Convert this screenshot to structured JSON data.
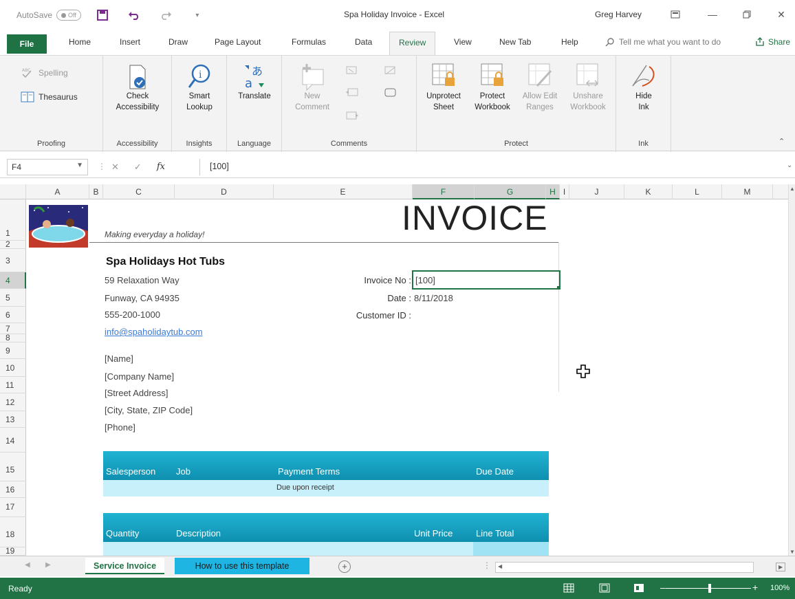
{
  "titlebar": {
    "autosave_label": "AutoSave",
    "autosave_state": "Off",
    "doc_title": "Spa Holiday Invoice  -  Excel",
    "user": "Greg Harvey"
  },
  "tabs": [
    "File",
    "Home",
    "Insert",
    "Draw",
    "Page Layout",
    "Formulas",
    "Data",
    "Review",
    "View",
    "New Tab",
    "Help"
  ],
  "active_tab": "Review",
  "tellme": "Tell me what you want to do",
  "share": "Share",
  "ribbon": {
    "proofing": {
      "spelling": "Spelling",
      "thesaurus": "Thesaurus",
      "label": "Proofing"
    },
    "accessibility": {
      "check_line1": "Check",
      "check_line2": "Accessibility",
      "label": "Accessibility"
    },
    "insights": {
      "smart_line1": "Smart",
      "smart_line2": "Lookup",
      "label": "Insights"
    },
    "language": {
      "translate": "Translate",
      "label": "Language"
    },
    "comments": {
      "new_line1": "New",
      "new_line2": "Comment",
      "label": "Comments"
    },
    "protect": {
      "unprotect_line1": "Unprotect",
      "unprotect_line2": "Sheet",
      "protect_line1": "Protect",
      "protect_line2": "Workbook",
      "allow_line1": "Allow Edit",
      "allow_line2": "Ranges",
      "unshare_line1": "Unshare",
      "unshare_line2": "Workbook",
      "label": "Protect"
    },
    "ink": {
      "hide_line1": "Hide",
      "hide_line2": "Ink",
      "label": "Ink"
    }
  },
  "formula": {
    "namebox": "F4",
    "value": "[100]"
  },
  "columns": [
    "A",
    "B",
    "C",
    "D",
    "E",
    "F",
    "G",
    "H",
    "I",
    "J",
    "K",
    "L",
    "M"
  ],
  "rows": [
    "1",
    "2",
    "3",
    "4",
    "5",
    "6",
    "7",
    "8",
    "9",
    "10",
    "11",
    "12",
    "13",
    "14",
    "15",
    "16",
    "17",
    "18",
    "19"
  ],
  "sheet": {
    "invoice_title": "INVOICE",
    "tagline": "Making everyday a holiday!",
    "company": "Spa Holidays Hot Tubs",
    "address1": "59 Relaxation Way",
    "address2": "Funway, CA 94935",
    "phone": "555-200-1000",
    "email": "info@spaholidaytub.com",
    "bill_name": "[Name]",
    "bill_company": "[Company Name]",
    "bill_street": "[Street Address]",
    "bill_city": "[City, State,  ZIP Code]",
    "bill_phone": "[Phone]",
    "invoice_no_label": "Invoice No :",
    "invoice_no": "[100]",
    "date_label": "Date :",
    "date": "8/11/2018",
    "customer_label": "Customer ID :",
    "header1": {
      "salesperson": "Salesperson",
      "job": "Job",
      "terms": "Payment Terms",
      "due": "Due Date"
    },
    "terms_value": "Due upon receipt",
    "header2": {
      "qty": "Quantity",
      "desc": "Description",
      "unit": "Unit Price",
      "total": "Line Total"
    }
  },
  "sheettabs": {
    "active": "Service Invoice",
    "other": "How to use this template"
  },
  "status": {
    "ready": "Ready",
    "zoom": "100%"
  },
  "colors": {
    "excel_green": "#217346",
    "band_blue": "#1fa9cc",
    "band_light": "#c7f0fb",
    "tab_blue": "#1fb5e2"
  }
}
